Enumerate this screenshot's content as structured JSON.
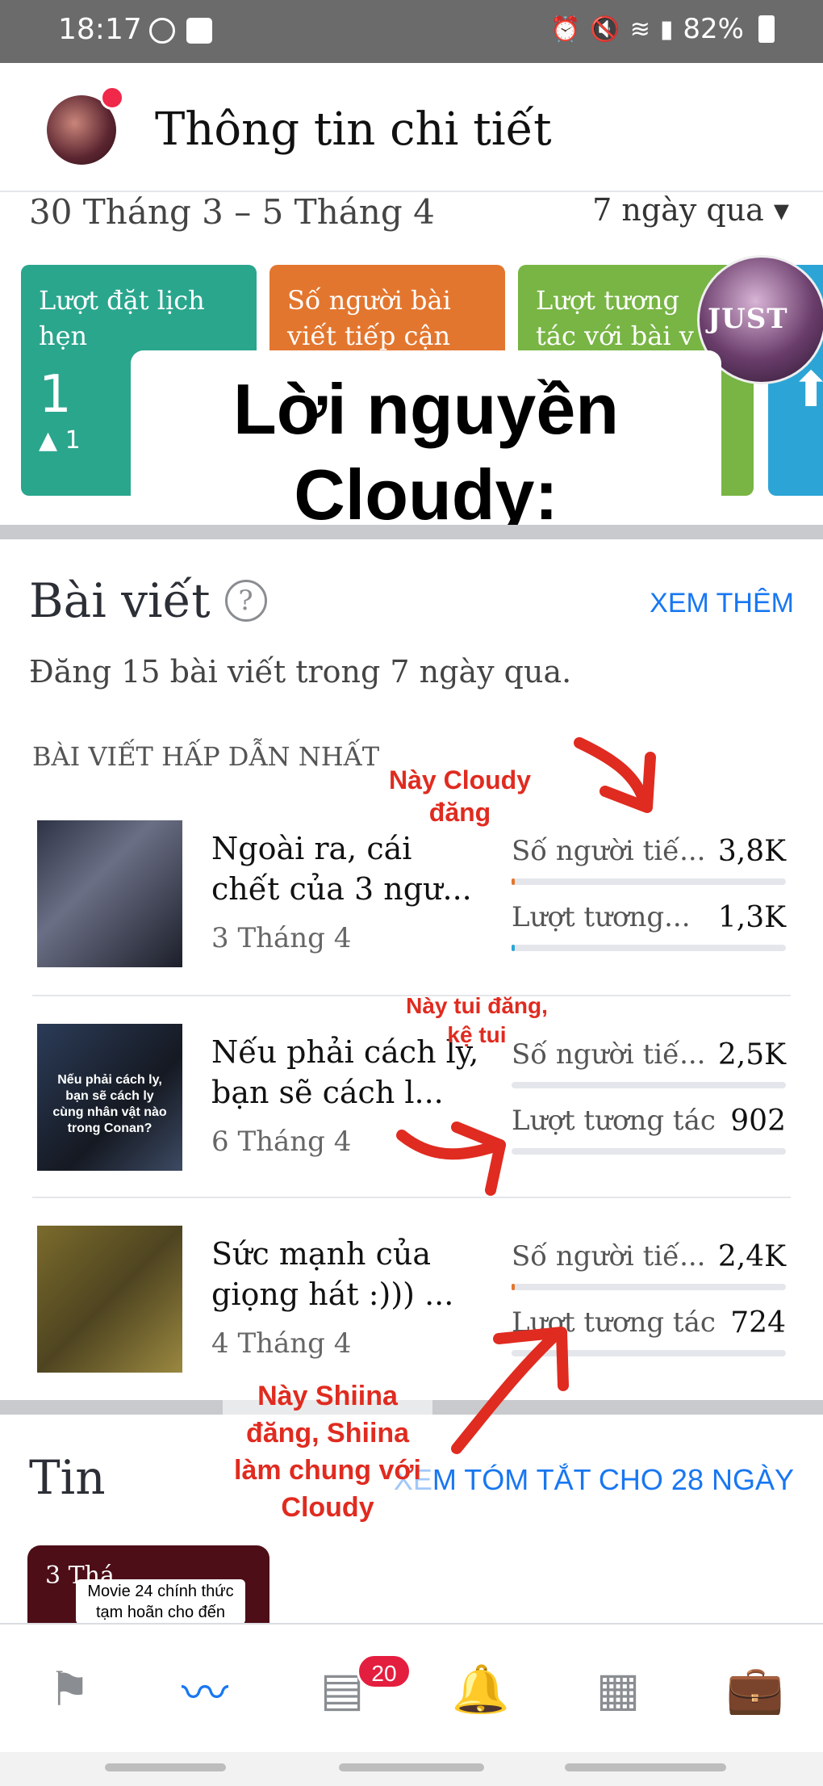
{
  "status_bar": {
    "time": "18:17",
    "battery": "82%",
    "icons_left": [
      "messenger-icon",
      "check-icon"
    ],
    "icons_right": [
      "alarm-icon",
      "mute-icon",
      "wifi-icon",
      "signal-icon",
      "battery-icon"
    ]
  },
  "header": {
    "title": "Thông tin chi tiết"
  },
  "date_row": {
    "range": "30 Tháng 3 – 5 Tháng 4",
    "filter": "7 ngày qua",
    "filter_icon": "caret-down-icon"
  },
  "cards": [
    {
      "label_line1": "Lượt đặt lịch",
      "label_line2": "hẹn",
      "value": "1",
      "change": "1",
      "color": "#2aa68d"
    },
    {
      "label_line1": "Số người bài",
      "label_line2": "viết tiếp cận",
      "color": "#e3762e"
    },
    {
      "label_line1": "Lượt tương",
      "label_line2": "tác với bài v",
      "color": "#78b544"
    },
    {
      "icon": "arrow-icon",
      "color": "#2ca5d6"
    }
  ],
  "overlay": {
    "line1": "Lời nguyền",
    "line2": "Cloudy:",
    "sticker_text": "JUST"
  },
  "posts_section": {
    "title": "Bài viết",
    "see_more": "XEM THÊM",
    "subtitle": "Đăng 15 bài viết trong 7 ngày qua.",
    "caption": "BÀI VIẾT HẤP DẪN NHẤT",
    "posts": [
      {
        "title": "Ngoài ra, cái chết của 3 ngư...",
        "date": "3 Tháng 4",
        "reach_label": "Số người tiế...",
        "reach_value": "3,8K",
        "reach_fraction": 0.01,
        "engagement_label": "Lượt tương...",
        "engagement_value": "1,3K",
        "engagement_fraction": 0.005
      },
      {
        "title": "Nếu phải cách ly, bạn sẽ cách l...",
        "date": "6 Tháng 4",
        "thumb_text": "Nếu phải cách ly, bạn sẽ cách ly cùng nhân vật nào trong Conan?",
        "reach_label": "Số người tiế...",
        "reach_value": "2,5K",
        "reach_fraction": 0.0,
        "engagement_label": "Lượt tương tác",
        "engagement_value": "902",
        "engagement_fraction": 0.0
      },
      {
        "title": "Sức mạnh của giọng hát :))) ...",
        "date": "4 Tháng 4",
        "reach_label": "Số người tiế...",
        "reach_value": "2,4K",
        "reach_fraction": 0.005,
        "engagement_label": "Lượt tương tác",
        "engagement_value": "724",
        "engagement_fraction": 0.0
      }
    ]
  },
  "annotations": {
    "note1": "Này Cloudy đăng",
    "note2": "Này tui đăng, kệ tui",
    "note3": "Này Shiina đăng, Shiina làm chung với Cloudy"
  },
  "stories_section": {
    "title": "Tin",
    "link": "XEM TÓM TẮT CHO 28 NGÀY",
    "card_date": "3 Thá",
    "card_text": "Movie 24 chính thức tạm hoãn cho đến"
  },
  "tab_bar": {
    "tabs": [
      "flag-icon",
      "insights-icon",
      "inbox-icon",
      "bell-icon",
      "calendar-icon",
      "briefcase-icon"
    ],
    "active_tab": "insights-icon",
    "inbox_badge": "20"
  },
  "colors": {
    "accent": "#1877f2",
    "annotation_red": "#e02b20",
    "badge_red": "#e41e3f"
  }
}
